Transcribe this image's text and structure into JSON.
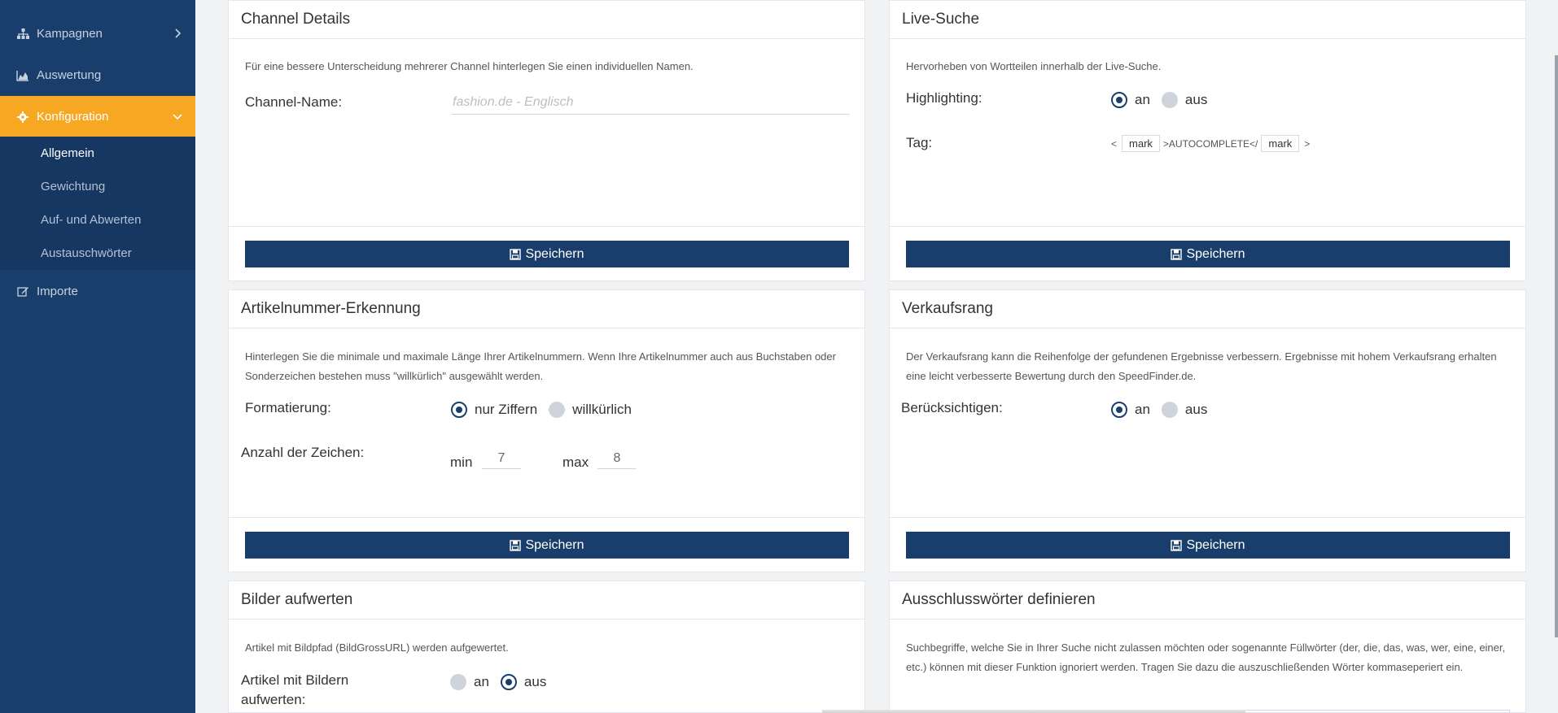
{
  "sidebar": {
    "items": [
      {
        "label": "Kampagnen",
        "icon": "sitemap-icon"
      },
      {
        "label": "Auswertung",
        "icon": "area-chart-icon"
      },
      {
        "label": "Konfiguration",
        "icon": "gear-icon"
      },
      {
        "label": "Importe",
        "icon": "edit-icon"
      }
    ],
    "subitems": [
      {
        "label": "Allgemein"
      },
      {
        "label": "Gewichtung"
      },
      {
        "label": "Auf- und Abwerten"
      },
      {
        "label": "Austauschwörter"
      }
    ]
  },
  "colors": {
    "sidebar": "#1a3e6b",
    "active": "#f7a823",
    "button": "#1a3e6b"
  },
  "cards": {
    "channel": {
      "title": "Channel Details",
      "desc": "Für eine bessere Unterscheidung mehrerer Channel hinterlegen Sie einen individuellen Namen.",
      "name_label": "Channel-Name:",
      "name_placeholder": "fashion.de - Englisch",
      "save": "Speichern"
    },
    "livesearch": {
      "title": "Live-Suche",
      "desc": "Hervorheben von Wortteilen innerhalb der Live-Suche.",
      "highlight_label": "Highlighting:",
      "opt_on": "an",
      "opt_off": "aus",
      "tag_label": "Tag:",
      "tag_lt": "<",
      "tag_open": "mark",
      "tag_mid": ">AUTOCOMPLETE</",
      "tag_close": "mark",
      "tag_gt": ">",
      "save": "Speichern"
    },
    "artikel": {
      "title": "Artikelnummer-Erkennung",
      "desc": "Hinterlegen Sie die minimale und maximale Länge Ihrer Artikelnummern. Wenn Ihre Artikelnummer auch aus Buchstaben oder Sonderzeichen bestehen muss \"willkürlich\" ausgewählt werden.",
      "format_label": "Formatierung:",
      "opt_digits": "nur Ziffern",
      "opt_any": "willkürlich",
      "count_label": "Anzahl der Zeichen:",
      "min_label": "min",
      "min_value": "7",
      "max_label": "max",
      "max_value": "8",
      "save": "Speichern"
    },
    "verkauf": {
      "title": "Verkaufsrang",
      "desc": "Der Verkaufsrang kann die Reihenfolge der gefundenen Ergebnisse verbessern. Ergebnisse mit hohem Verkaufsrang erhalten eine leicht verbesserte Bewertung durch den SpeedFinder.de.",
      "consider_label": "Berücksichtigen:",
      "opt_on": "an",
      "opt_off": "aus",
      "save": "Speichern"
    },
    "bilder": {
      "title": "Bilder aufwerten",
      "desc": "Artikel mit Bildpfad (BildGrossURL) werden aufgewertet.",
      "label": "Artikel mit Bildern aufwerten:",
      "opt_on": "an",
      "opt_off": "aus"
    },
    "ausschluss": {
      "title": "Ausschlusswörter definieren",
      "desc": "Suchbegriffe, welche Sie in Ihrer Suche nicht zulassen möchten oder sogenannte Füllwörter (der, die, das, was, wer, eine, einer, etc.) können mit dieser Funktion ignoriert werden. Tragen Sie dazu die auszuschließenden Wörter kommaseperiert ein."
    }
  }
}
